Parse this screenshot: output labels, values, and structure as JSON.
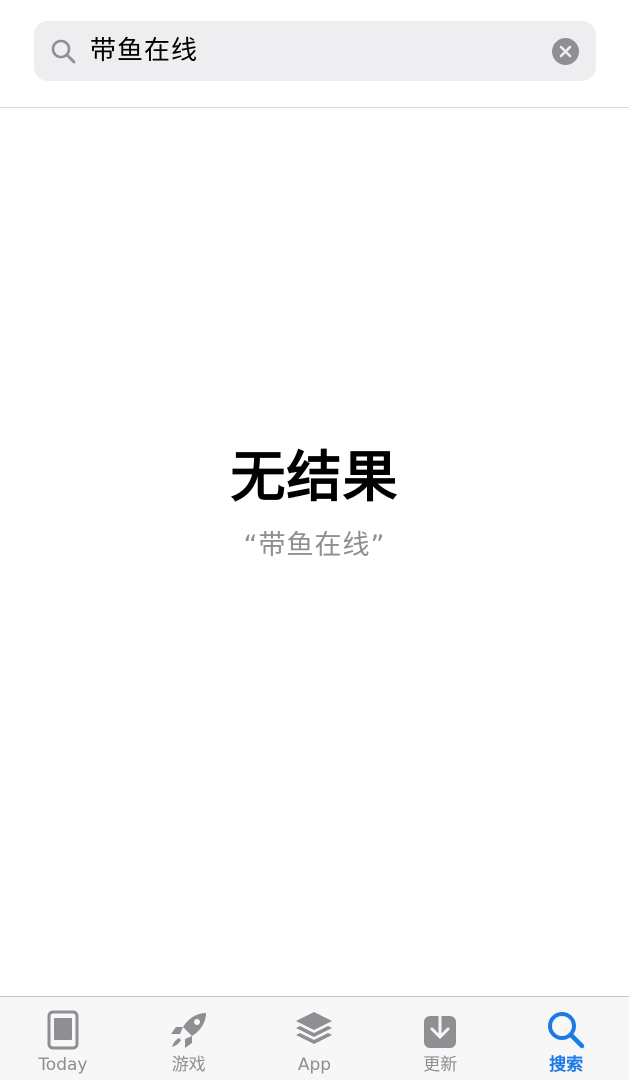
{
  "search": {
    "query": "带鱼在线"
  },
  "results": {
    "empty_title": "无结果",
    "empty_query": "“带鱼在线”"
  },
  "tab_bar": {
    "active_color": "#1a7ae6",
    "inactive_color": "#8e8e93",
    "tabs": [
      {
        "label": "Today",
        "icon": "today-icon",
        "active": false
      },
      {
        "label": "游戏",
        "icon": "rocket-icon",
        "active": false
      },
      {
        "label": "App",
        "icon": "layers-icon",
        "active": false
      },
      {
        "label": "更新",
        "icon": "download-icon",
        "active": false
      },
      {
        "label": "搜索",
        "icon": "search-icon",
        "active": true
      }
    ]
  }
}
